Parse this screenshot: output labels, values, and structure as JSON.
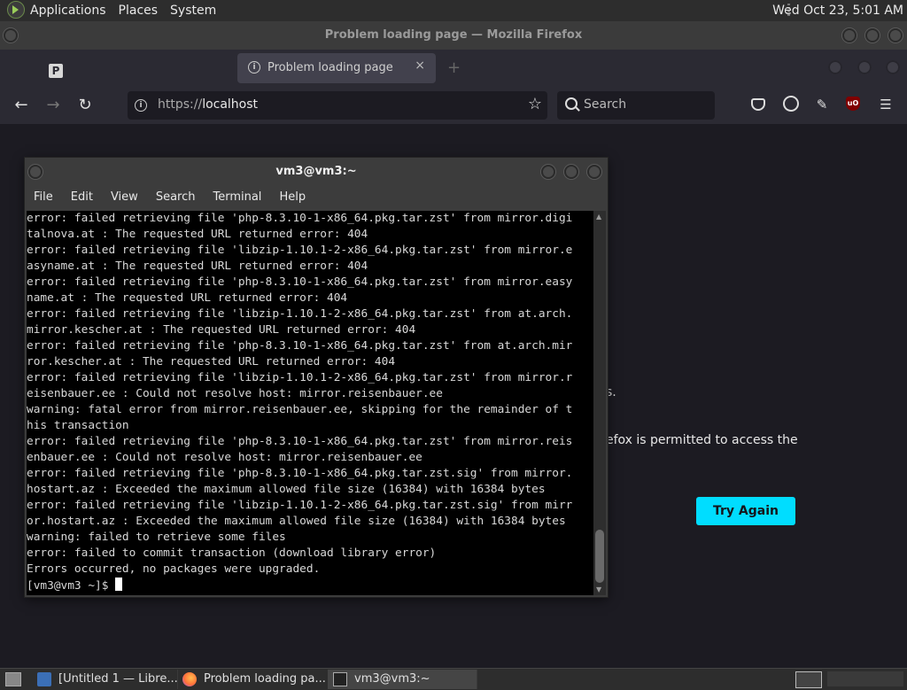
{
  "top_panel": {
    "menus": [
      "Applications",
      "Places",
      "System"
    ],
    "clock": "Wed Oct 23,  5:01 AM"
  },
  "firefox": {
    "window_title": "Problem loading page — Mozilla Firefox",
    "active_tab_title": "Problem loading page",
    "tab_close": "×",
    "new_tab": "+",
    "url_protocol": "https://",
    "url_host": "localhost",
    "search_placeholder": "Search",
    "content": {
      "fragment_line1": "s.",
      "fragment_line2": "efox is permitted to access the",
      "try_again": "Try Again"
    },
    "colors": {
      "accent": "#00ddff",
      "chrome_bg": "#2b2a33",
      "content_bg": "#1c1b22"
    }
  },
  "terminal": {
    "title": "vm3@vm3:~",
    "menu": [
      "File",
      "Edit",
      "View",
      "Search",
      "Terminal",
      "Help"
    ],
    "lines": [
      "error: failed retrieving file 'php-8.3.10-1-x86_64.pkg.tar.zst' from mirror.digi",
      "talnova.at : The requested URL returned error: 404",
      "error: failed retrieving file 'libzip-1.10.1-2-x86_64.pkg.tar.zst' from mirror.e",
      "asyname.at : The requested URL returned error: 404",
      "error: failed retrieving file 'php-8.3.10-1-x86_64.pkg.tar.zst' from mirror.easy",
      "name.at : The requested URL returned error: 404",
      "error: failed retrieving file 'libzip-1.10.1-2-x86_64.pkg.tar.zst' from at.arch.",
      "mirror.kescher.at : The requested URL returned error: 404",
      "error: failed retrieving file 'php-8.3.10-1-x86_64.pkg.tar.zst' from at.arch.mir",
      "ror.kescher.at : The requested URL returned error: 404",
      "error: failed retrieving file 'libzip-1.10.1-2-x86_64.pkg.tar.zst' from mirror.r",
      "eisenbauer.ee : Could not resolve host: mirror.reisenbauer.ee",
      "warning: fatal error from mirror.reisenbauer.ee, skipping for the remainder of t",
      "his transaction",
      "error: failed retrieving file 'php-8.3.10-1-x86_64.pkg.tar.zst' from mirror.reis",
      "enbauer.ee : Could not resolve host: mirror.reisenbauer.ee",
      "error: failed retrieving file 'php-8.3.10-1-x86_64.pkg.tar.zst.sig' from mirror.",
      "hostart.az : Exceeded the maximum allowed file size (16384) with 16384 bytes",
      "error: failed retrieving file 'libzip-1.10.1-2-x86_64.pkg.tar.zst.sig' from mirr",
      "or.hostart.az : Exceeded the maximum allowed file size (16384) with 16384 bytes",
      "warning: failed to retrieve some files",
      "error: failed to commit transaction (download library error)",
      "Errors occurred, no packages were upgraded."
    ],
    "prompt": "[vm3@vm3 ~]$ "
  },
  "taskbar": {
    "items": [
      {
        "label": "[Untitled 1 — Libre...",
        "icon": "libreoffice-writer-icon"
      },
      {
        "label": "Problem loading pa...",
        "icon": "firefox-icon"
      },
      {
        "label": "vm3@vm3:~",
        "icon": "terminal-icon"
      }
    ]
  }
}
